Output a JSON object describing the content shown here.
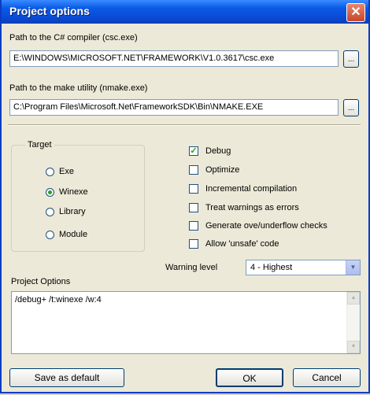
{
  "window": {
    "title": "Project options",
    "close_glyph": "✕"
  },
  "compiler": {
    "label": "Path to the C# compiler (csc.exe)",
    "value": "E:\\WINDOWS\\MICROSOFT.NET\\FRAMEWORK\\V1.0.3617\\csc.exe",
    "browse_label": "..."
  },
  "make": {
    "label": "Path to the make utility (nmake.exe)",
    "value": "C:\\Program Files\\Microsoft.Net\\FrameworkSDK\\Bin\\NMAKE.EXE",
    "browse_label": "..."
  },
  "target": {
    "title": "Target",
    "options": [
      {
        "label": "Exe",
        "selected": false
      },
      {
        "label": "Winexe",
        "selected": true
      },
      {
        "label": "Library",
        "selected": false
      },
      {
        "label": "Module",
        "selected": false
      }
    ]
  },
  "checks": [
    {
      "label": "Debug",
      "checked": true
    },
    {
      "label": "Optimize",
      "checked": false
    },
    {
      "label": "Incremental compilation",
      "checked": false
    },
    {
      "label": "Treat warnings as errors",
      "checked": false
    },
    {
      "label": "Generate ove/underflow checks",
      "checked": false
    },
    {
      "label": "Allow 'unsafe' code",
      "checked": false
    }
  ],
  "warning_level": {
    "label": "Warning level",
    "value": "4 - Highest"
  },
  "project_options": {
    "label": "Project Options",
    "value": "/debug+ /t:winexe /w:4"
  },
  "buttons": {
    "save_default": "Save as default",
    "ok": "OK",
    "cancel": "Cancel"
  },
  "colors": {
    "titlebar": "#0a4cd8",
    "close": "#c8452a",
    "check_mark": "#21a121"
  }
}
